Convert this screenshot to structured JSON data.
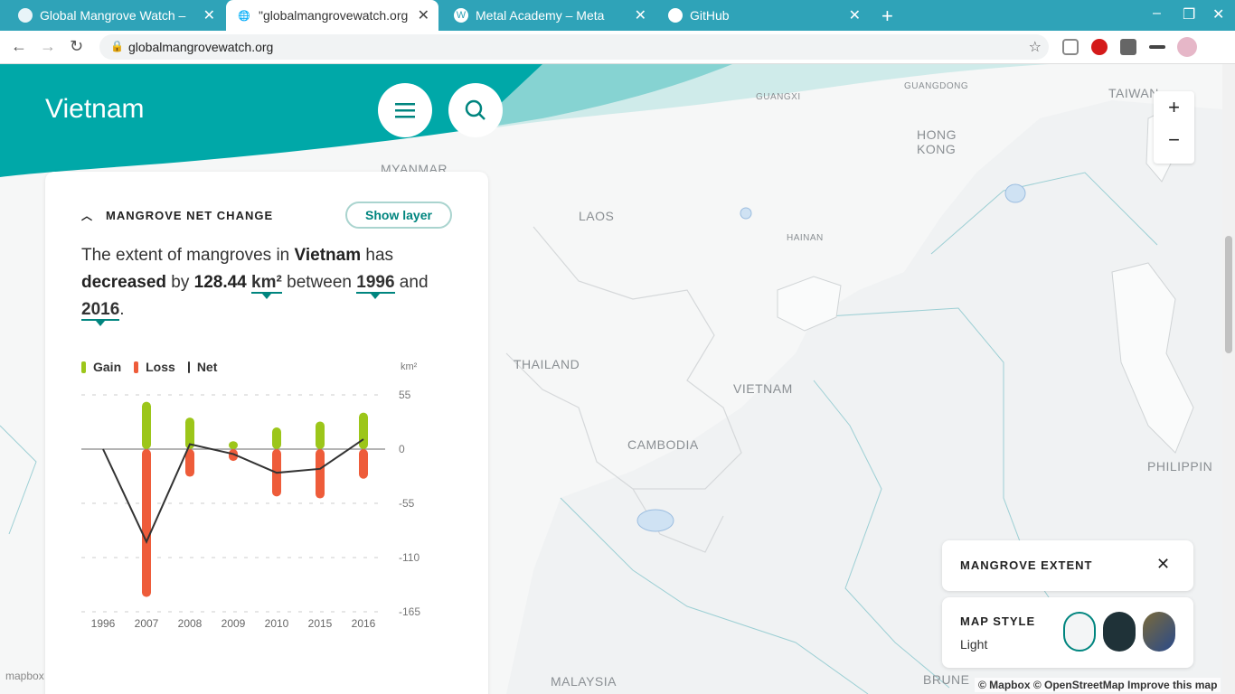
{
  "browser": {
    "tabs": [
      {
        "title": "Global Mangrove Watch – ",
        "active": false
      },
      {
        "title": "\"globalmangrovewatch.org",
        "active": true
      },
      {
        "title": "Metal Academy – Meta",
        "active": false
      },
      {
        "title": "GitHub",
        "active": false
      }
    ],
    "url": "globalmangrovewatch.org"
  },
  "header": {
    "country": "Vietnam"
  },
  "map": {
    "labels": [
      "GUANGXI",
      "GUANGDONG",
      "TAIWAN",
      "HONG",
      "KONG",
      "MYANMAR",
      "LAOS",
      "HAINAN",
      "THAILAND",
      "VIETNAM",
      "CAMBODIA",
      "PHILIPPIN",
      "MALAYSIA",
      "BRUNE"
    ],
    "attribution": "© Mapbox © OpenStreetMap  Improve this map",
    "mapbox_logo": "mapbox"
  },
  "card": {
    "title": "MANGROVE NET CHANGE",
    "show_layer": "Show layer",
    "sentence": {
      "p1": "The extent of mangroves in ",
      "country": "Vietnam",
      "p2": " has ",
      "trend": "decreased",
      "p3": " by ",
      "value": "128.44",
      "unit": "km²",
      "p4": " between ",
      "start": "1996",
      "p5": " and ",
      "end": "2016",
      "p6": "."
    },
    "legend": {
      "gain": "Gain",
      "loss": "Loss",
      "net": "Net"
    },
    "unit_label": "km²"
  },
  "chart_data": {
    "type": "bar",
    "categories": [
      "1996",
      "2007",
      "2008",
      "2009",
      "2010",
      "2015",
      "2016"
    ],
    "series": [
      {
        "name": "Gain",
        "values": [
          0,
          48,
          32,
          8,
          22,
          28,
          37
        ]
      },
      {
        "name": "Loss",
        "values": [
          0,
          -150,
          -28,
          -12,
          -48,
          -50,
          -30
        ]
      },
      {
        "name": "Net",
        "values": [
          0,
          -94,
          5,
          -5,
          -24,
          -20,
          10
        ]
      }
    ],
    "ylim": [
      -165,
      55
    ],
    "yticks": [
      55,
      0,
      -55,
      -110,
      -165
    ],
    "colors": {
      "gain": "#9cc61a",
      "loss": "#ee5c3a",
      "net": "#333333"
    }
  },
  "widgets": {
    "extent_title": "MANGROVE EXTENT",
    "map_style_title": "MAP STYLE",
    "map_style_value": "Light"
  }
}
